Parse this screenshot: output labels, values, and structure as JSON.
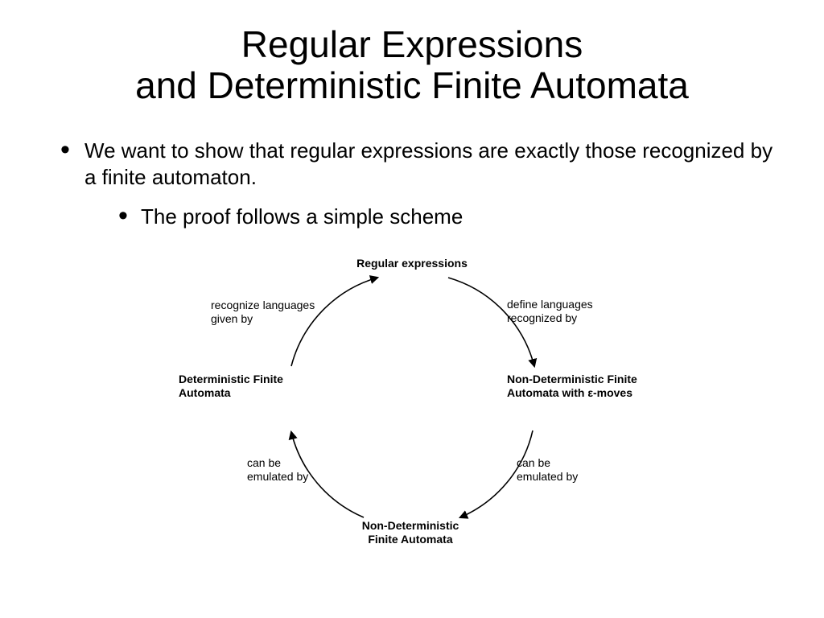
{
  "title_line1": "Regular Expressions",
  "title_line2": "and Deterministic Finite Automata",
  "bullet1": "We want to show that regular expressions are exactly those recognized by a finite automaton.",
  "bullet2": "The proof follows a simple scheme",
  "diagram": {
    "nodes": {
      "re": "Regular expressions",
      "nfae": "Non-Deterministic Finite Automata with ε-moves",
      "nfa": "Non-Deterministic Finite Automata",
      "dfa": "Deterministic Finite Automata"
    },
    "edges": {
      "re_nfae": "define languages recognized by",
      "nfae_nfa": "can be emulated by",
      "nfa_dfa": "can be emulated by",
      "dfa_re": "recognize languages given by"
    }
  }
}
